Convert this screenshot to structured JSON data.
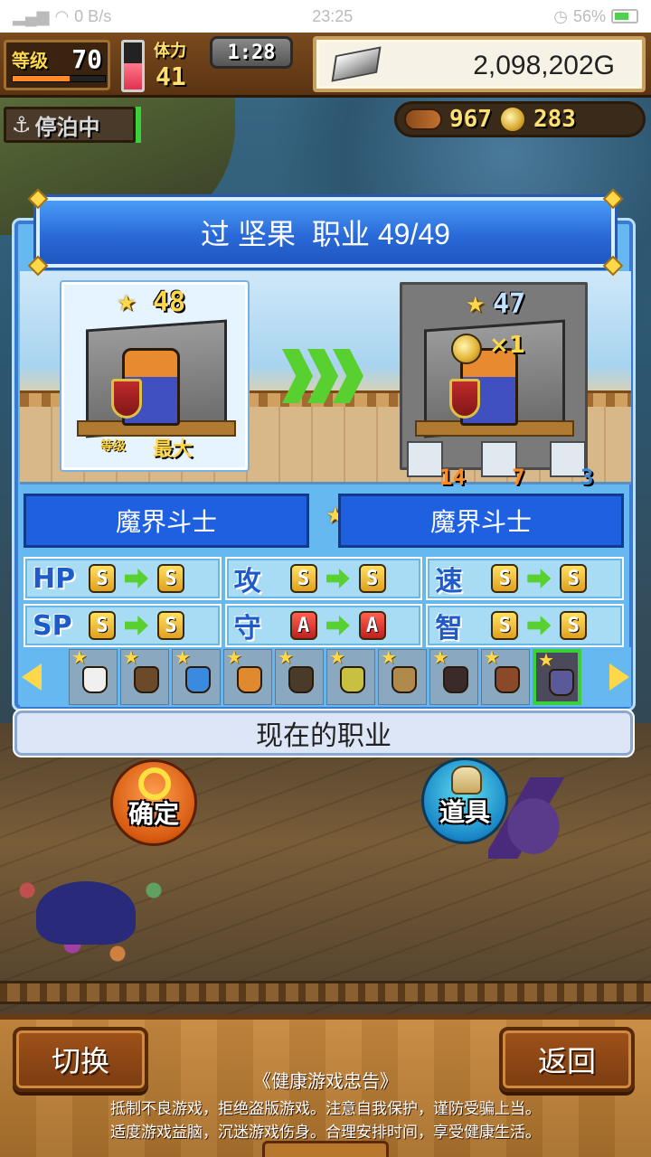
{
  "status_bar": {
    "network": "0 B/s",
    "time": "23:25",
    "battery": "56%"
  },
  "hud": {
    "level_label": "等级",
    "level_value": "70",
    "level_progress": 0.62,
    "stamina_label": "体力",
    "stamina_value": "41",
    "stamina_fill": 0.55,
    "timer": "1:28",
    "gold": "2,098,202G",
    "dock_status": "停泊中",
    "resource_wood": "967",
    "resource_coin": "283"
  },
  "panel": {
    "title_name": "过 坚果",
    "title_job": "职业 49/49",
    "current": {
      "rank": "48",
      "level_label": "等级",
      "level_value": "最大"
    },
    "next": {
      "rank": "47",
      "coin_multiplier": "×1",
      "items": [
        "14",
        "7",
        "3"
      ]
    },
    "job_current": "魔界斗士",
    "job_new": "魔界斗士",
    "stats": [
      {
        "name": "HP",
        "from": "S",
        "to": "S"
      },
      {
        "name": "攻",
        "from": "S",
        "to": "S"
      },
      {
        "name": "速",
        "from": "S",
        "to": "S"
      },
      {
        "name": "SP",
        "from": "S",
        "to": "S"
      },
      {
        "name": "守",
        "from": "A",
        "to": "A"
      },
      {
        "name": "智",
        "from": "S",
        "to": "S"
      }
    ],
    "current_job_label": "现在的职业"
  },
  "actions": {
    "confirm": "确定",
    "items": "道具",
    "switch": "切换",
    "back": "返回"
  },
  "health_notice": {
    "title": "《健康游戏忠告》",
    "line1": "抵制不良游戏，拒绝盗版游戏。注意自我保护，谨防受骗上当。",
    "line2": "适度游戏益脑，沉迷游戏伤身。合理安排时间，享受健康生活。"
  },
  "colors": {
    "panel_blue": "#66b8f0",
    "header_blue": "#2a6ad8",
    "grade_gold": "#e0a020",
    "grade_red": "#c02020",
    "arrow_green": "#58d030"
  }
}
